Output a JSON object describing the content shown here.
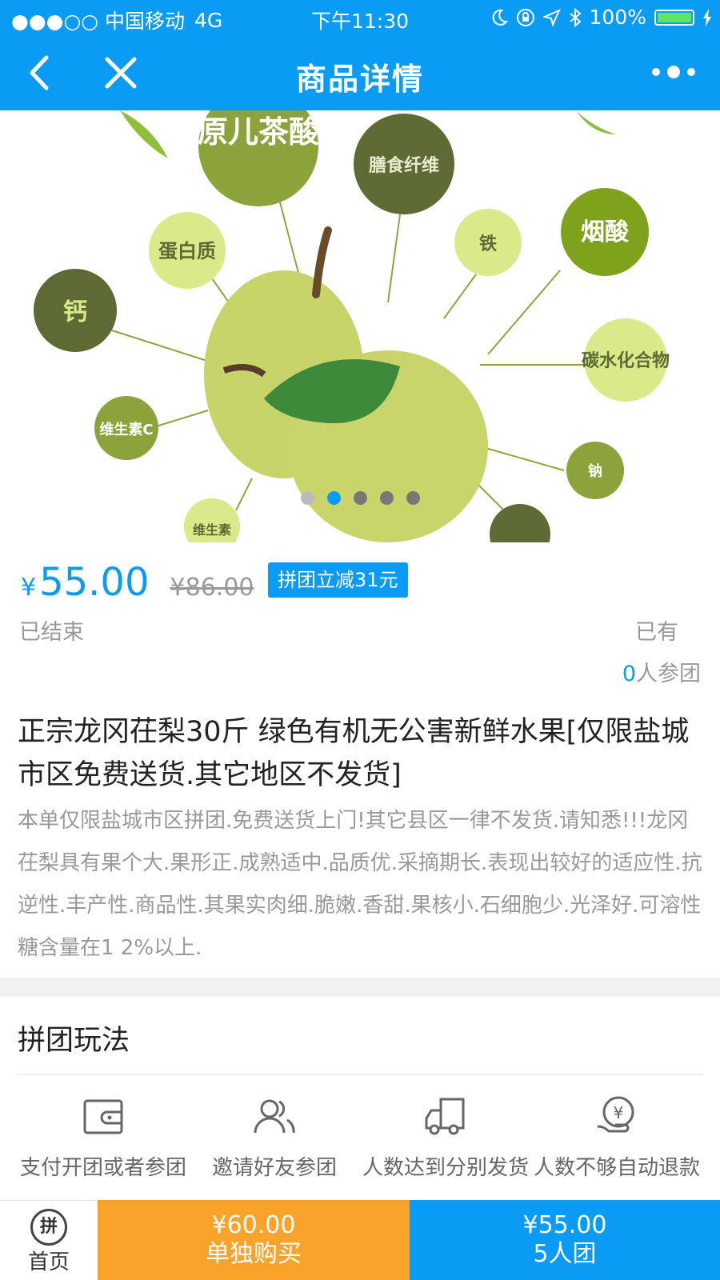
{
  "status_bar": {
    "carrier": "●●●○○ 中国移动",
    "network": "4G",
    "time": "下午11:30",
    "battery": "100%"
  },
  "nav": {
    "title": "商品详情",
    "back_icon": "chevron-left-icon",
    "close_icon": "close-icon",
    "more_icon": "more-icon"
  },
  "hero": {
    "labels": [
      "原儿茶酸",
      "膳食纤维",
      "蛋白质",
      "铁",
      "烟酸",
      "钙",
      "碳水化合物",
      "维生素C",
      "钠",
      "维生素"
    ],
    "carousel": {
      "count": 5,
      "active_index": 1
    }
  },
  "product": {
    "currency": "¥",
    "price": "55.00",
    "original_price": "¥86.00",
    "discount_badge": "拼团立减31元",
    "status": "已结束",
    "has_label": "已有",
    "joined_count": "0",
    "joined_suffix": "人参团",
    "title": "正宗龙冈茌梨30斤 绿色有机无公害新鲜水果[仅限盐城市区免费送货.其它地区不发货]",
    "description": "本单仅限盐城市区拼团.免费送货上门!其它县区一律不发货.请知悉!!!龙冈茌梨具有果个大.果形正.成熟适中.品质优.采摘期长.表现出较好的适应性.抗逆性.丰产性.商品性.其果实肉细.脆嫩.香甜.果核小.石细胞少.光泽好.可溶性糖含量在1 2%以上."
  },
  "rules": {
    "title": "拼团玩法",
    "steps": [
      {
        "label": "支付开团或者参团",
        "icon": "wallet-icon"
      },
      {
        "label": "邀请好友参团",
        "icon": "users-icon"
      },
      {
        "label": "人数达到分别发货",
        "icon": "truck-icon"
      },
      {
        "label": "人数不够自动退款",
        "icon": "refund-icon"
      }
    ]
  },
  "bottom_bar": {
    "home_label": "首页",
    "home_icon_text": "拼",
    "single_price": "¥60.00",
    "single_label": "单独购买",
    "group_price": "¥55.00",
    "group_label": "5人团",
    "colors": {
      "single": "#f9a32b",
      "group": "#0a9bf5"
    }
  },
  "colors": {
    "accent": "#0a9bf5"
  }
}
